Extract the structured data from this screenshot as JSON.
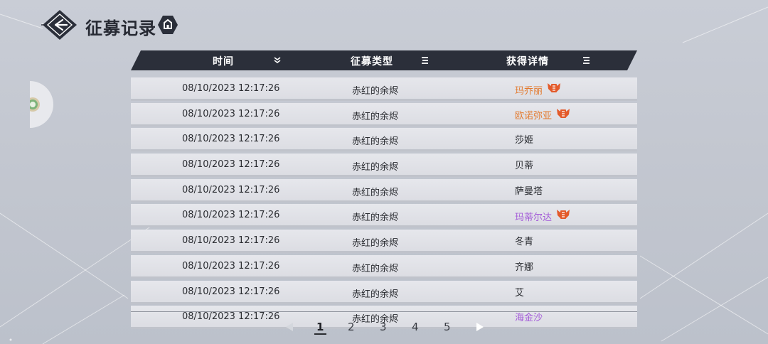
{
  "header": {
    "title": "征募记录",
    "back_icon": "back-arrow-icon",
    "home_icon": "home-icon"
  },
  "table": {
    "columns": [
      {
        "label": "时间",
        "icon": "sort-descending-icon"
      },
      {
        "label": "征募类型",
        "icon": "filter-icon"
      },
      {
        "label": "获得详情",
        "icon": "filter-icon"
      }
    ],
    "rows": [
      {
        "time": "08/10/2023 12:17:26",
        "type": "赤红的余烬",
        "result": "玛乔丽",
        "rarity": "orange",
        "badge": true
      },
      {
        "time": "08/10/2023 12:17:26",
        "type": "赤红的余烬",
        "result": "欧诺弥亚",
        "rarity": "orange",
        "badge": true
      },
      {
        "time": "08/10/2023 12:17:26",
        "type": "赤红的余烬",
        "result": "莎姬",
        "rarity": "normal",
        "badge": false
      },
      {
        "time": "08/10/2023 12:17:26",
        "type": "赤红的余烬",
        "result": "贝蒂",
        "rarity": "normal",
        "badge": false
      },
      {
        "time": "08/10/2023 12:17:26",
        "type": "赤红的余烬",
        "result": "萨曼塔",
        "rarity": "normal",
        "badge": false
      },
      {
        "time": "08/10/2023 12:17:26",
        "type": "赤红的余烬",
        "result": "玛蒂尔达",
        "rarity": "purple",
        "badge": true
      },
      {
        "time": "08/10/2023 12:17:26",
        "type": "赤红的余烬",
        "result": "冬青",
        "rarity": "normal",
        "badge": false
      },
      {
        "time": "08/10/2023 12:17:26",
        "type": "赤红的余烬",
        "result": "齐娜",
        "rarity": "normal",
        "badge": false
      },
      {
        "time": "08/10/2023 12:17:26",
        "type": "赤红的余烬",
        "result": "艾",
        "rarity": "normal",
        "badge": false
      },
      {
        "time": "08/10/2023 12:17:26",
        "type": "赤红的余烬",
        "result": "海金沙",
        "rarity": "purple",
        "badge": false
      }
    ]
  },
  "pagination": {
    "pages": [
      "1",
      "2",
      "3",
      "4",
      "5"
    ],
    "current": "1",
    "prev_icon": "prev-arrow-icon",
    "next_icon": "next-arrow-icon"
  },
  "colors": {
    "orange": "#e37a2e",
    "purple": "#a35ad8",
    "normal": "#2a2c31",
    "header_bar": "#2b2f3a"
  }
}
